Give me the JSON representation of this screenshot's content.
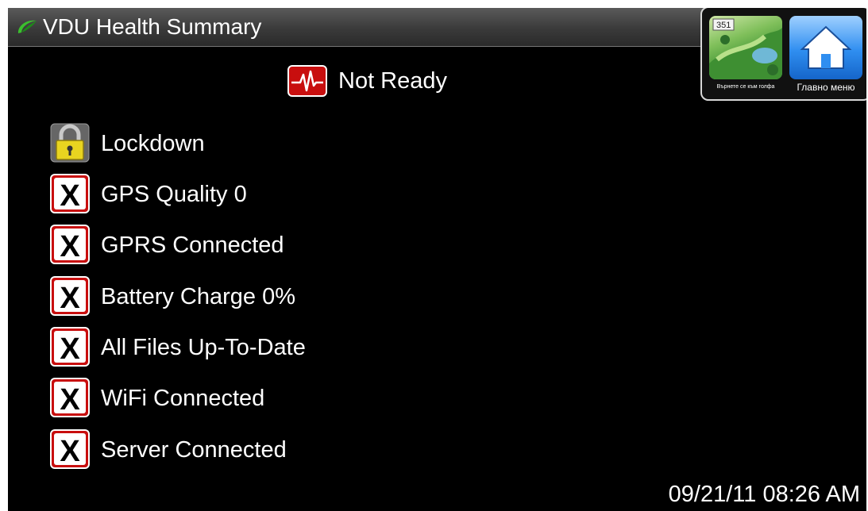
{
  "window": {
    "title": "VDU Health Summary",
    "logo_icon": "swoosh-logo"
  },
  "nav": {
    "golf_button": {
      "label": "Върнете се към голфа",
      "badge": "351",
      "icon": "golf-course-thumbnail"
    },
    "home_button": {
      "label": "Главно меню",
      "icon": "home-icon"
    }
  },
  "status": {
    "text": "Not Ready",
    "icon": "heartbeat-icon",
    "color": "#d01010"
  },
  "checks": [
    {
      "label": "Lockdown",
      "icon": "lock-icon",
      "state": "locked"
    },
    {
      "label": "GPS Quality 0",
      "icon": "x-icon",
      "state": "fail"
    },
    {
      "label": "GPRS Connected",
      "icon": "x-icon",
      "state": "fail"
    },
    {
      "label": "Battery Charge 0%",
      "icon": "x-icon",
      "state": "fail"
    },
    {
      "label": "All Files Up-To-Date",
      "icon": "x-icon",
      "state": "fail"
    },
    {
      "label": "WiFi Connected",
      "icon": "x-icon",
      "state": "fail"
    },
    {
      "label": "Server Connected",
      "icon": "x-icon",
      "state": "fail"
    }
  ],
  "timestamp": "09/21/11 08:26 AM",
  "colors": {
    "background": "#000000",
    "fail_red": "#c80e0e",
    "lock_yellow": "#e8d420",
    "home_blue": "#2f8ef0"
  }
}
